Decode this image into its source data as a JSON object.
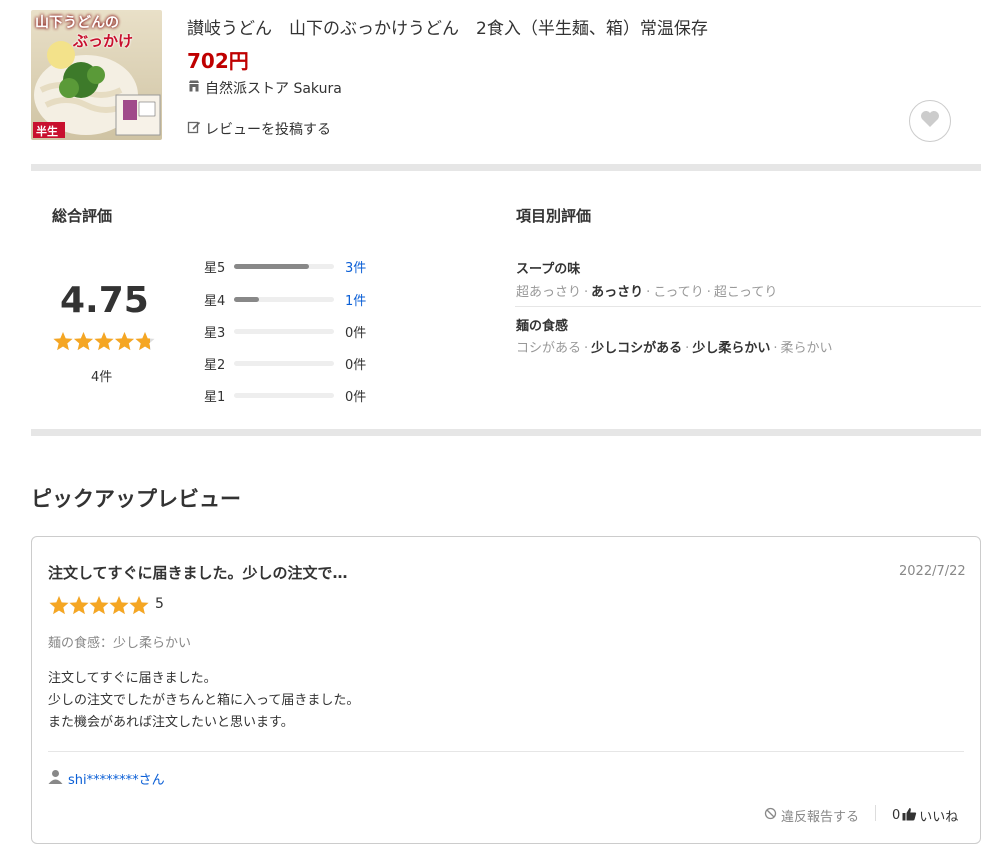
{
  "product": {
    "title": "讃岐うどん　山下のぶっかけうどん　2食入（半生麺、箱）常温保存",
    "price": "702円",
    "store": "自然派ストア Sakura",
    "post_review": "レビューを投稿する",
    "image_text_top": "山下うどんの",
    "image_text_mid": "ぶっかけ",
    "image_badge": "半生"
  },
  "overall": {
    "heading": "総合評価",
    "score": "4.75",
    "stars": 4.75,
    "count": "4件",
    "distribution": [
      {
        "label": "星5",
        "count": "3件",
        "ratio": 0.75,
        "link": true
      },
      {
        "label": "星4",
        "count": "1件",
        "ratio": 0.25,
        "link": true
      },
      {
        "label": "星3",
        "count": "0件",
        "ratio": 0,
        "link": false
      },
      {
        "label": "星2",
        "count": "0件",
        "ratio": 0,
        "link": false
      },
      {
        "label": "星1",
        "count": "0件",
        "ratio": 0,
        "link": false
      }
    ]
  },
  "items": {
    "heading": "項目別評価",
    "list": [
      {
        "name": "スープの味",
        "options": [
          "超あっさり",
          "あっさり",
          "こってり",
          "超こってり"
        ],
        "selected": "あっさり"
      },
      {
        "name": "麺の食感",
        "options": [
          "コシがある",
          "少しコシがある",
          "少し柔らかい",
          "柔らかい"
        ],
        "selected": [
          "少しコシがある",
          "少し柔らかい"
        ]
      }
    ]
  },
  "pickup": {
    "heading": "ピックアップレビュー",
    "review": {
      "title": "注文してすぐに届きました。少しの注文で…",
      "date": "2022/7/22",
      "rating": 5,
      "score": "5",
      "attribute": "麺の食感：少し柔らかい",
      "body1": "注文してすぐに届きました。",
      "body2": "少しの注文でしたがきちんと箱に入って届きました。",
      "body3": "また機会があれば注文したいと思います。",
      "user": "shi********さん",
      "report": "違反報告する",
      "like_count": "0",
      "like_label": "いいね"
    }
  },
  "colors": {
    "accent": "#bf0000",
    "link": "#0b5fd6",
    "star": "#f5a623"
  }
}
